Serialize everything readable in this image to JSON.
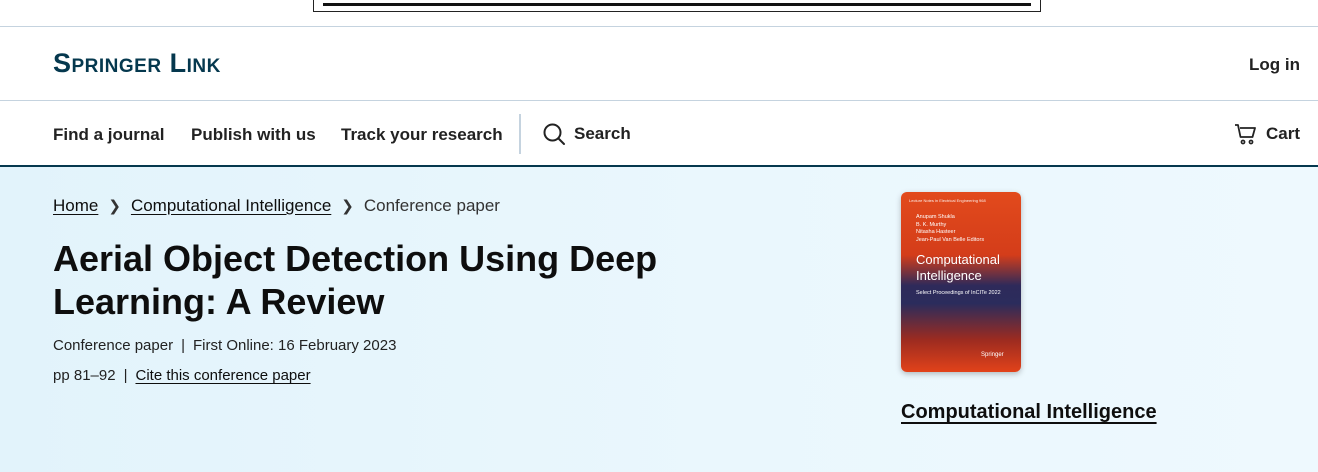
{
  "header": {
    "logo": "Springer Link",
    "login_label": "Log in"
  },
  "nav": {
    "items": [
      {
        "label": "Find a journal"
      },
      {
        "label": "Publish with us"
      },
      {
        "label": "Track your research"
      }
    ],
    "search_label": "Search",
    "cart_label": "Cart"
  },
  "breadcrumb": {
    "items": [
      "Home",
      "Computational Intelligence"
    ],
    "current": "Conference paper"
  },
  "article": {
    "title": "Aerial Object Detection Using Deep Learning: A Review",
    "type": "Conference paper",
    "first_online": "First Online: 16 February 2023",
    "pages": "pp 81–92",
    "cite_label": "Cite this conference paper"
  },
  "book": {
    "cover": {
      "series": "Lecture Notes in Electrical Engineering 968",
      "editors": [
        "Anupam Shukla",
        "B. K. Murthy",
        "Nitasha Hasteer",
        "Jean-Paul Van Belle  Editors"
      ],
      "title": "Computational Intelligence",
      "subtitle": "Select Proceedings of InCITe 2022",
      "publisher": "Springer"
    },
    "link_label": "Computational Intelligence"
  },
  "colors": {
    "brand": "#05384e",
    "hero_bg": "#e6f5fc",
    "divider": "#c5d3df"
  },
  "icons": [
    "chevron-right-icon",
    "search-icon",
    "cart-icon"
  ]
}
